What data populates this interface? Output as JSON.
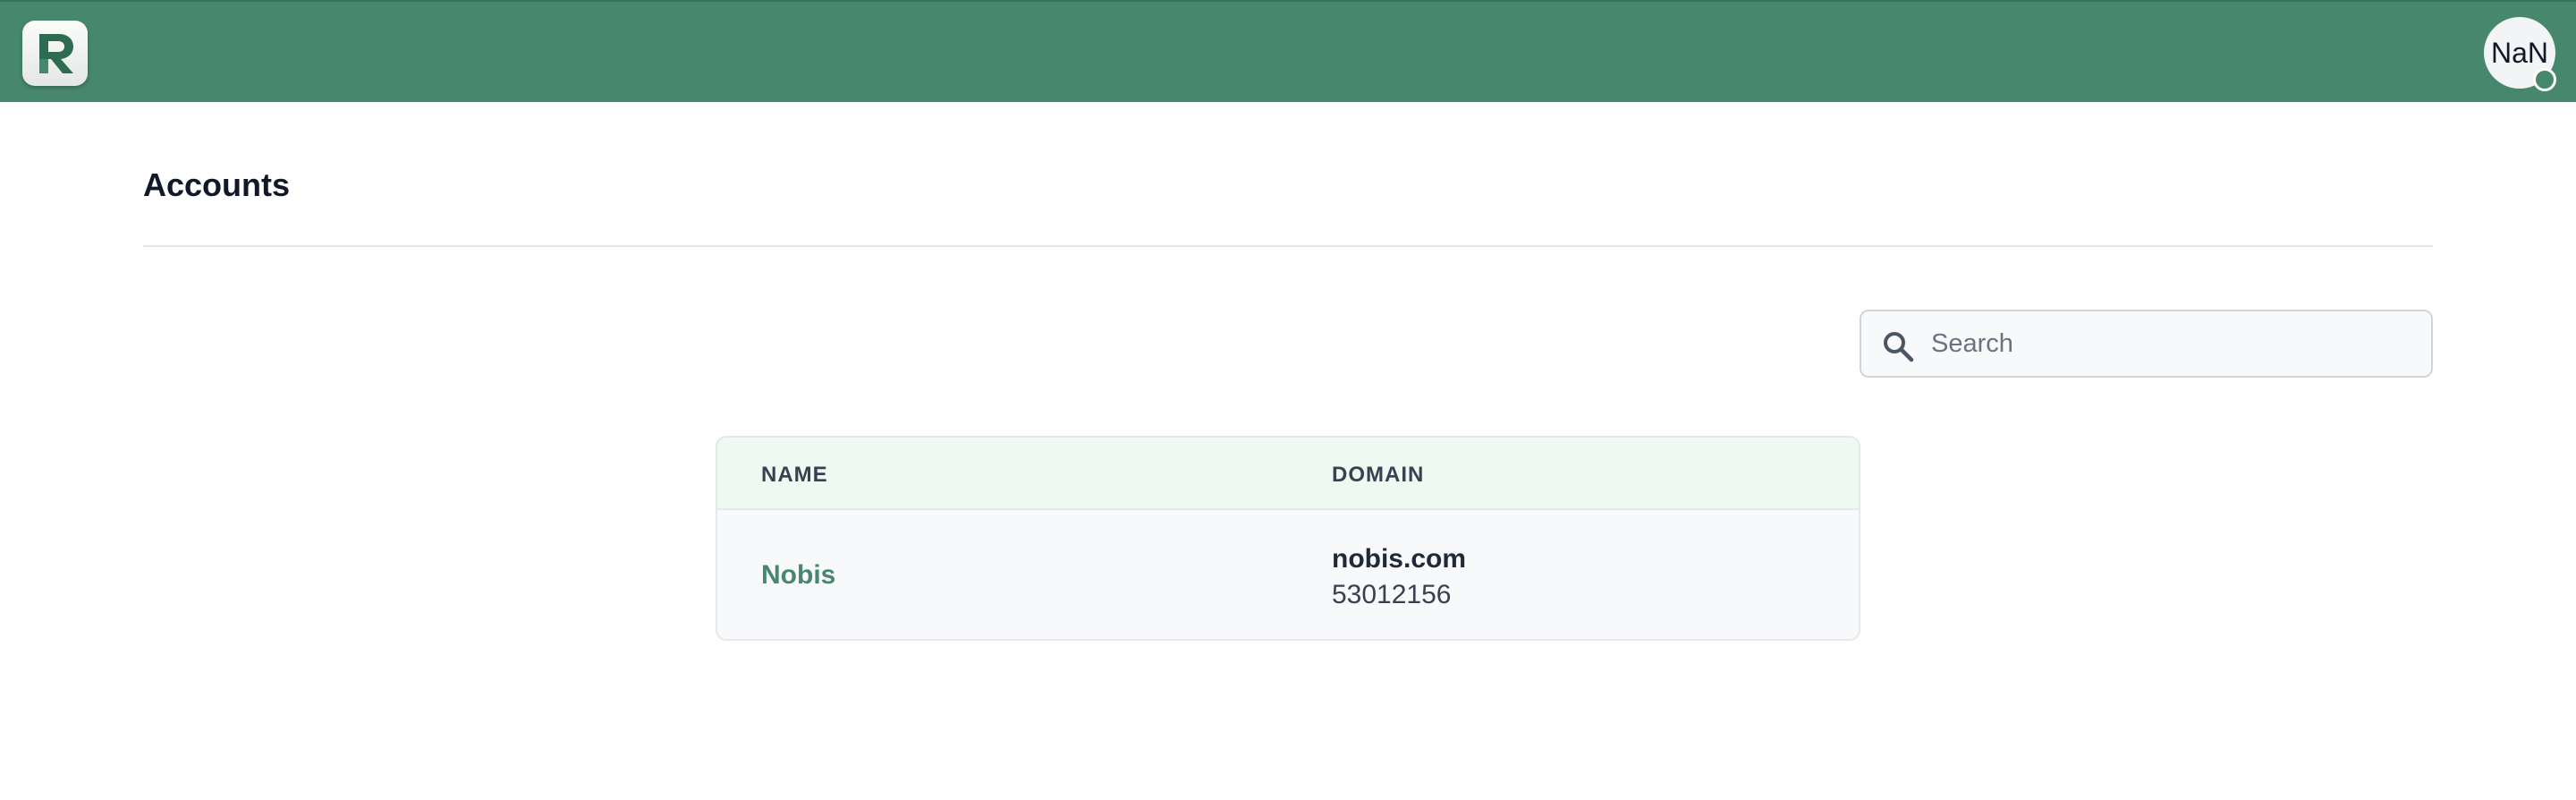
{
  "header": {
    "logo_letter": "R",
    "avatar_text": "NaN"
  },
  "page": {
    "title": "Accounts"
  },
  "search": {
    "placeholder": "Search",
    "value": ""
  },
  "table": {
    "columns": [
      "NAME",
      "DOMAIN"
    ],
    "rows": [
      {
        "name": "Nobis",
        "domain": "nobis.com",
        "id": "53012156"
      }
    ]
  },
  "colors": {
    "brand": "#47876d",
    "header_row": "#edf9f1",
    "status_online": "#47876d"
  }
}
